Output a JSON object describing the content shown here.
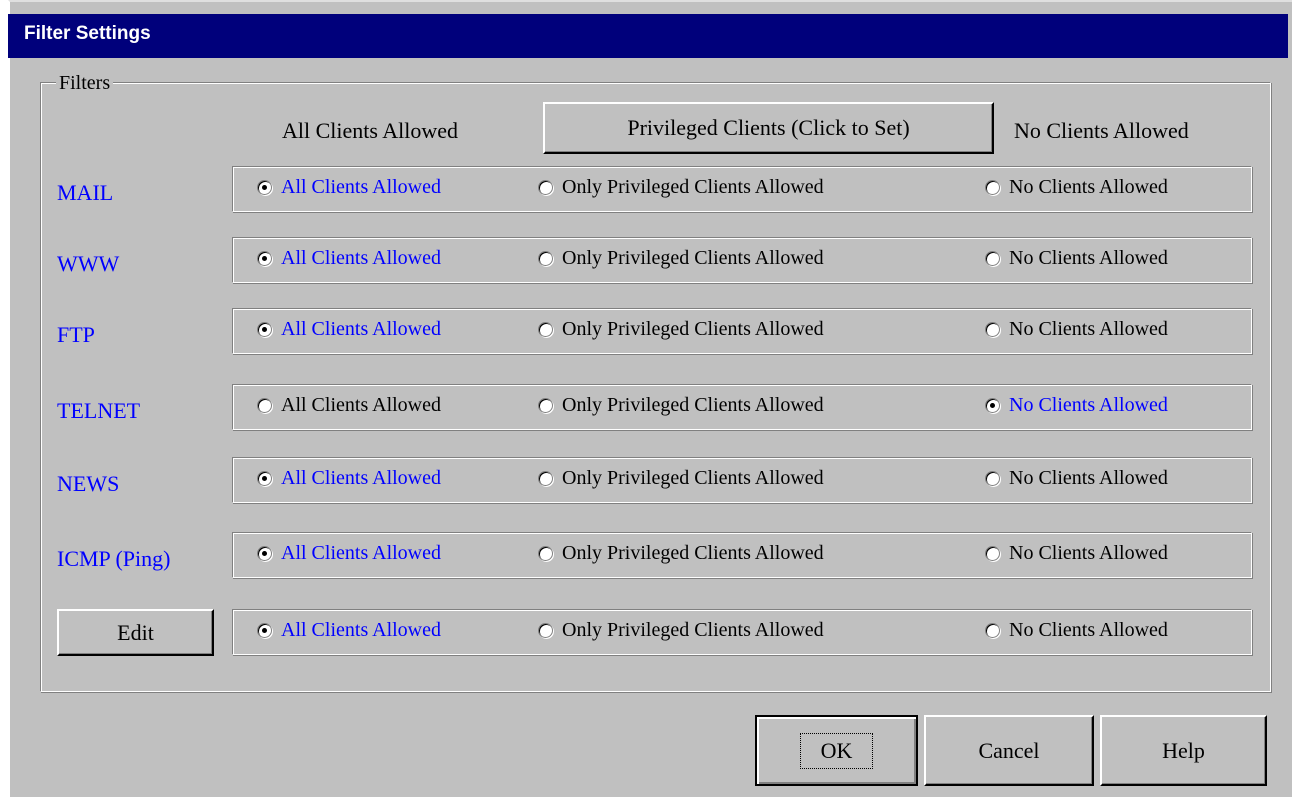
{
  "window": {
    "title": "Filter Settings"
  },
  "group": {
    "legend": "Filters"
  },
  "columns": {
    "all": "All Clients Allowed",
    "privileged_button": "Privileged Clients (Click to Set)",
    "none": "No Clients Allowed"
  },
  "rows": [
    {
      "label": "MAIL",
      "selected": "all",
      "options": {
        "all": "All Clients Allowed",
        "privileged": "Only Privileged Clients Allowed",
        "none": "No Clients Allowed"
      }
    },
    {
      "label": "WWW",
      "selected": "all",
      "options": {
        "all": "All Clients Allowed",
        "privileged": "Only Privileged Clients Allowed",
        "none": "No Clients Allowed"
      }
    },
    {
      "label": "FTP",
      "selected": "all",
      "options": {
        "all": "All Clients Allowed",
        "privileged": "Only Privileged Clients Allowed",
        "none": "No Clients Allowed"
      }
    },
    {
      "label": "TELNET",
      "selected": "none",
      "options": {
        "all": "All Clients Allowed",
        "privileged": "Only Privileged Clients Allowed",
        "none": "No Clients Allowed"
      }
    },
    {
      "label": "NEWS",
      "selected": "all",
      "options": {
        "all": "All Clients Allowed",
        "privileged": "Only Privileged Clients Allowed",
        "none": "No Clients Allowed"
      }
    },
    {
      "label": "ICMP (Ping)",
      "selected": "all",
      "options": {
        "all": "All Clients Allowed",
        "privileged": "Only Privileged Clients Allowed",
        "none": "No Clients Allowed"
      }
    },
    {
      "label": "Edit",
      "selected": "all",
      "options": {
        "all": "All Clients Allowed",
        "privileged": "Only Privileged Clients Allowed",
        "none": "No Clients Allowed"
      }
    }
  ],
  "buttons": {
    "ok": "OK",
    "cancel": "Cancel",
    "help": "Help"
  },
  "colors": {
    "titlebar": "#00007b",
    "face": "#c0c0c0",
    "selected_text": "#0000ff"
  }
}
